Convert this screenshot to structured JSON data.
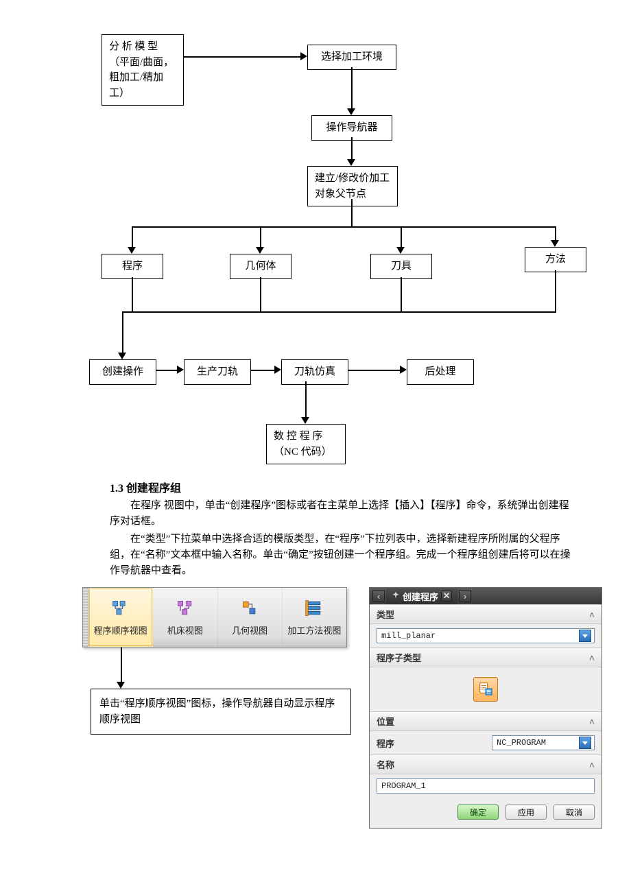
{
  "flow": {
    "analyze": "分 析 模 型（平面/曲面，粗加工/精加工）",
    "selectEnv": "选择加工环境",
    "navigator": "操作导航器",
    "buildParent": "建立/修改价加工对象父节点",
    "program": "程序",
    "geometry": "几何体",
    "tool": "刀具",
    "method": "方法",
    "createOp": "创建操作",
    "genPath": "生产刀轨",
    "simPath": "刀轨仿真",
    "postProc": "后处理",
    "ncCode": "数 控 程 序（NC 代码）"
  },
  "section": {
    "heading": "1.3 创建程序组",
    "p1": "在程序 视图中，单击“创建程序”图标或者在主菜单上选择【插入】【程序】命令，系统弹出创建程序对话框。",
    "p2": "在“类型”下拉菜单中选择合适的模版类型，在“程序”下拉列表中，选择新建程序所附属的父程序组，在“名称”文本框中输入名称。单击“确定”按钮创建一个程序组。完成一个程序组创建后将可以在操作导航器中查看。"
  },
  "toolbar": {
    "btn1": "程序顺序视图",
    "btn2": "机床视图",
    "btn3": "几何视图",
    "btn4": "加工方法视图"
  },
  "callout": "单击“程序顺序视图”图标，操作导航器自动显示程序顺序视图",
  "dialog": {
    "title": "创建程序",
    "secType": "类型",
    "typeValue": "mill_planar",
    "secSubtype": "程序子类型",
    "secPosition": "位置",
    "posLabel": "程序",
    "posValue": "NC_PROGRAM",
    "secName": "名称",
    "nameValue": "PROGRAM_1",
    "ok": "确定",
    "apply": "应用",
    "cancel": "取消"
  }
}
